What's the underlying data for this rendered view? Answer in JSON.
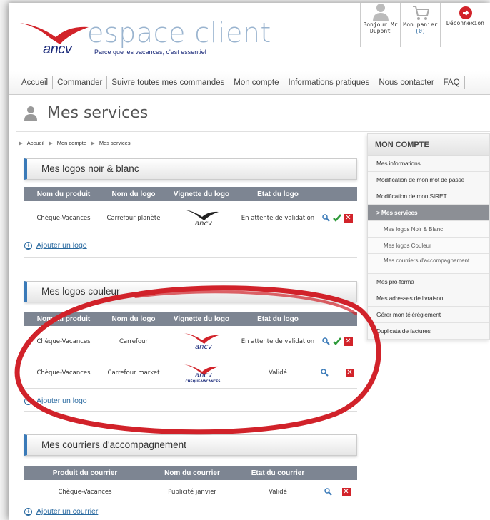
{
  "header": {
    "logo_text": "ancv",
    "title": "espace client",
    "tagline": "Parce que les vacances, c'est essentiel",
    "user_greeting_line1": "Bonjour Mr",
    "user_greeting_line2": "Dupont",
    "cart_label": "Mon panier",
    "cart_count": "(0)",
    "logout_label": "Déconnexion"
  },
  "nav": {
    "items": [
      "Accueil",
      "Commander",
      "Suivre toutes mes commandes",
      "Mon compte",
      "Informations pratiques",
      "Nous contacter",
      "FAQ"
    ]
  },
  "page": {
    "title": "Mes services"
  },
  "breadcrumb": [
    "Accueil",
    "Mon compte",
    "Mes services"
  ],
  "sections": {
    "nb": {
      "title": "Mes logos noir & blanc",
      "headers": [
        "Nom du produit",
        "Nom du logo",
        "Vignette du logo",
        "Etat du logo"
      ],
      "rows": [
        {
          "product": "Chèque-Vacances",
          "logo": "Carrefour planète",
          "vignette": "ancv",
          "state": "En attente de validation"
        }
      ],
      "add": "Ajouter un logo"
    },
    "color": {
      "title": "Mes logos couleur",
      "headers": [
        "Nom du produit",
        "Nom du logo",
        "Vignette du logo",
        "Etat du logo"
      ],
      "rows": [
        {
          "product": "Chèque-Vacances",
          "logo": "Carrefour",
          "vignette": "ancv",
          "state": "En attente de validation"
        },
        {
          "product": "Chèque-Vacances",
          "logo": "Carrefour market",
          "vignette": "ancv",
          "vignette_sub": "CHÈQUE-VACANCES",
          "state": "Validé"
        }
      ],
      "add": "Ajouter un logo"
    },
    "letters": {
      "title": "Mes courriers d'accompagnement",
      "headers": [
        "Produit du courrier",
        "Nom du courrier",
        "Etat du courrier"
      ],
      "rows": [
        {
          "product": "Chèque-Vacances",
          "name": "Publicité janvier",
          "state": "Validé"
        }
      ],
      "add": "Ajouter un courrier"
    }
  },
  "side": {
    "title": "MON COMPTE",
    "items": [
      "Mes informations",
      "Modification de mon mot de passe",
      "Modification de mon SIRET"
    ],
    "active": "> Mes services",
    "subs": [
      "Mes logos Noir & Blanc",
      "Mes logos Couleur",
      "Mes courriers d'accompagnement"
    ],
    "items2": [
      "Mes pro-forma",
      "Mes adresses de livraison",
      "Gérer mon téléréglement",
      "Duplicata de factures"
    ]
  },
  "colors": {
    "brand_red": "#d2232a",
    "brand_blue": "#1a2a7a",
    "accent_blue": "#3a7ab8",
    "annotation_red": "#d1222a"
  }
}
